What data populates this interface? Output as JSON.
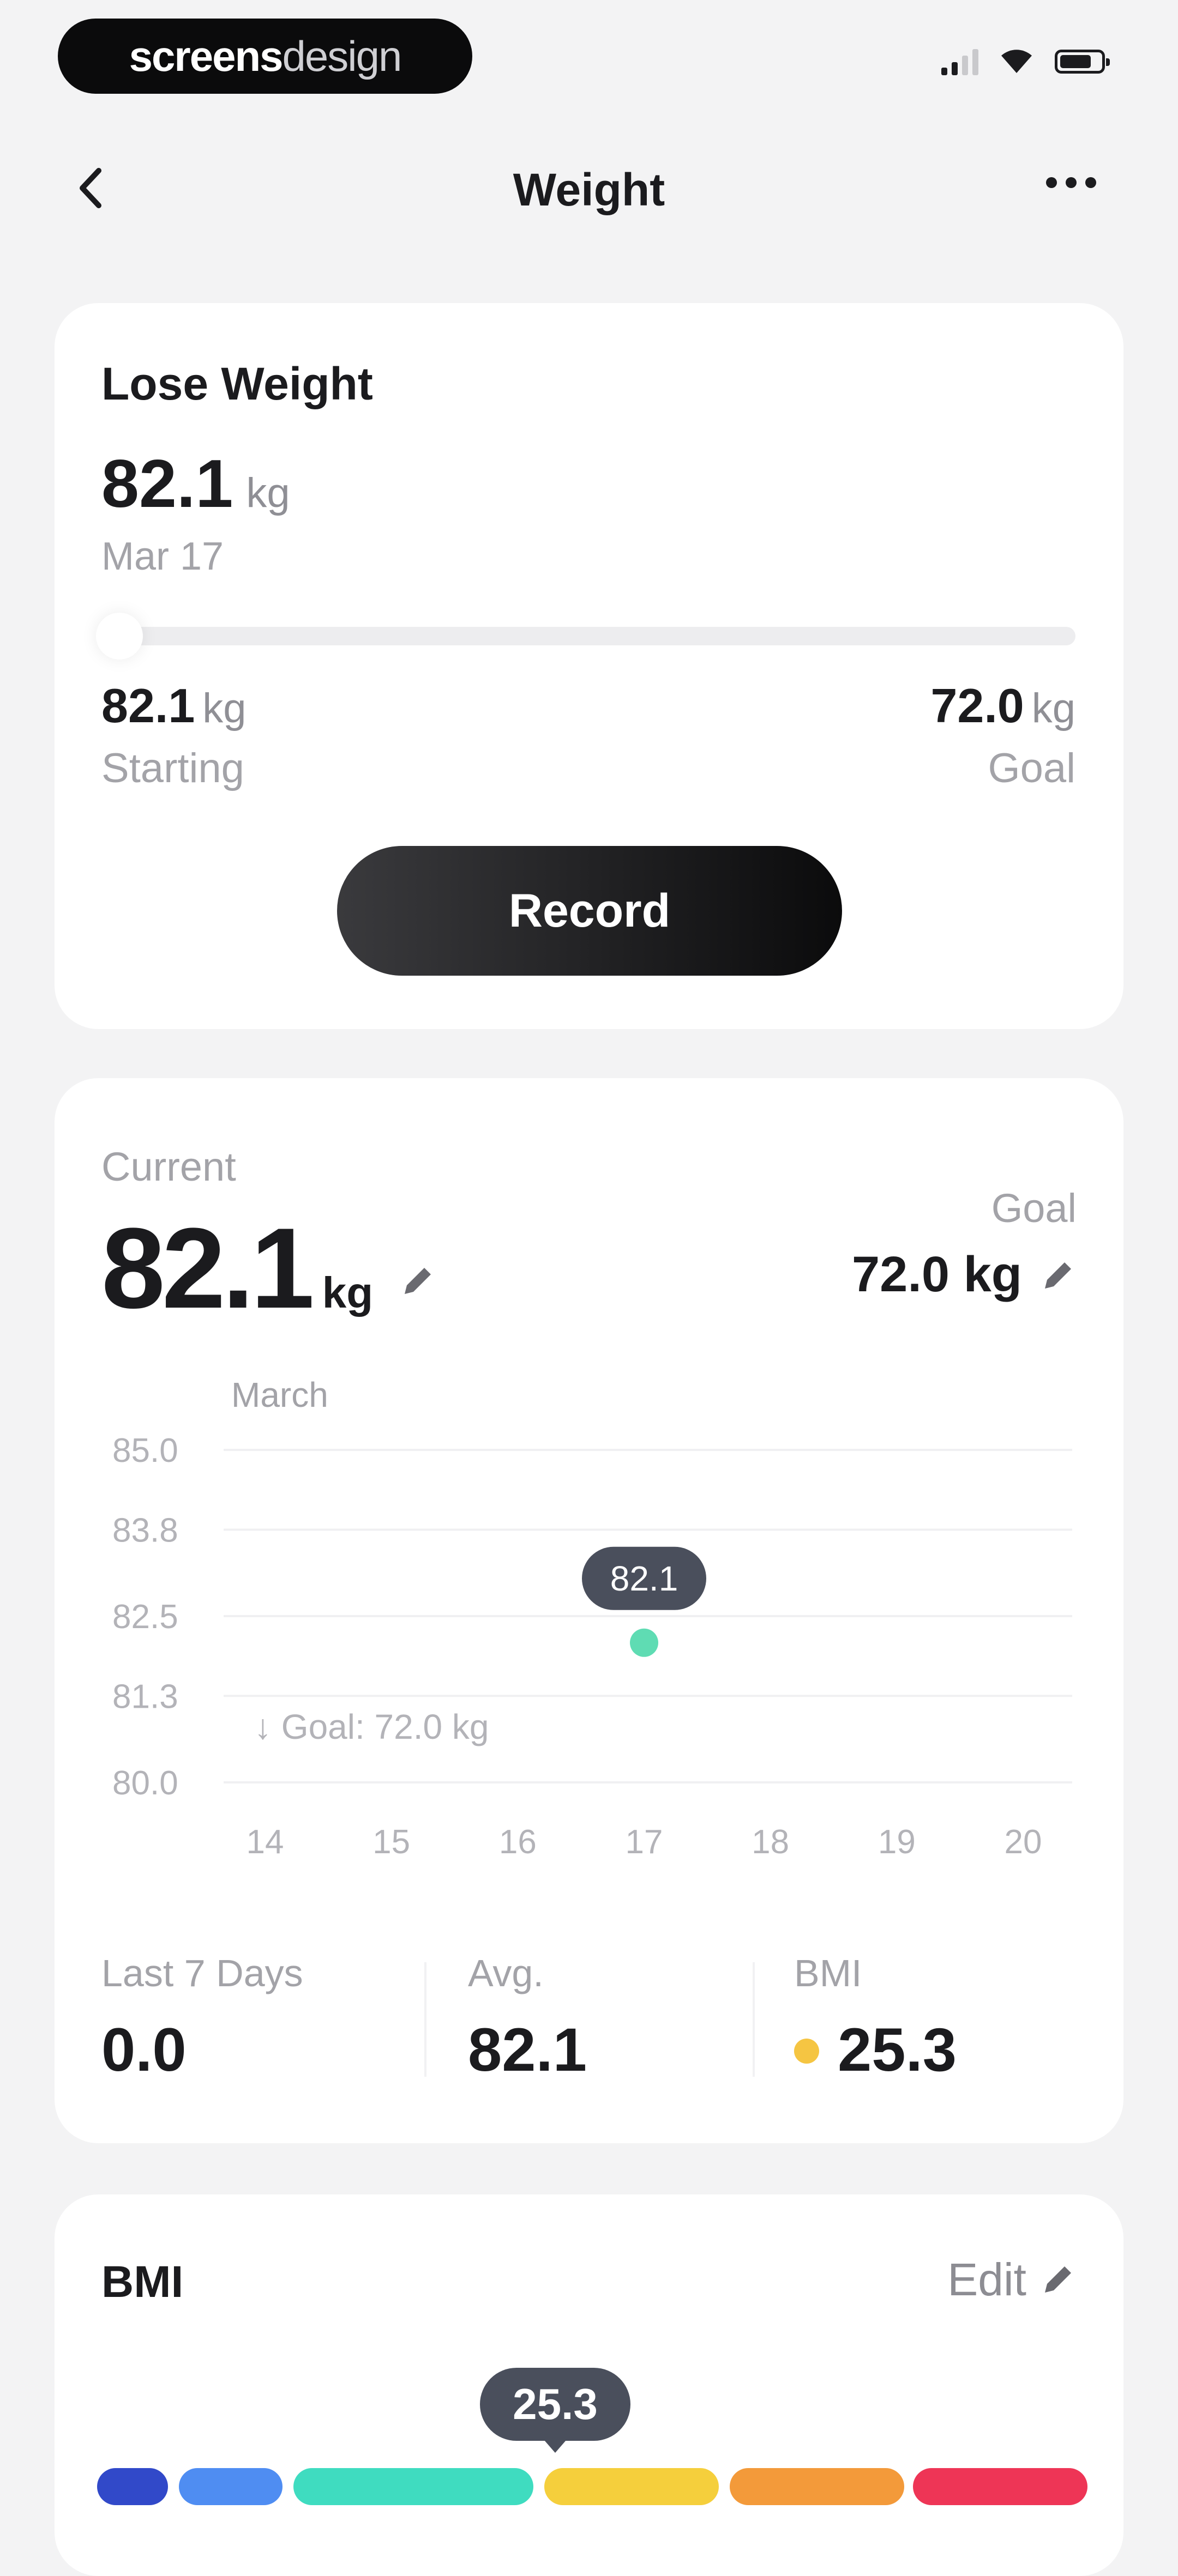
{
  "status_bar": {
    "brand_thin": "screens",
    "brand_bold": "design"
  },
  "header": {
    "title": "Weight"
  },
  "goal_card": {
    "title": "Lose Weight",
    "current_value": "82.1",
    "unit": "kg",
    "date": "Mar 17",
    "progress_fraction": 0,
    "start_value": "82.1",
    "start_label": "Starting",
    "goal_value": "72.0",
    "goal_label": "Goal",
    "record_label": "Record"
  },
  "summary_card": {
    "current_label": "Current",
    "current_value": "82.1",
    "current_unit": "kg",
    "goal_label": "Goal",
    "goal_value": "72.0 kg",
    "stats": [
      {
        "label": "Last 7 Days",
        "value": "0.0"
      },
      {
        "label": "Avg.",
        "value": "82.1"
      },
      {
        "label": "BMI",
        "value": "25.3"
      }
    ],
    "bmi_dot_color": "#f5c542"
  },
  "chart_data": {
    "type": "scatter",
    "month_label": "March",
    "y_ticks": [
      "85.0",
      "83.8",
      "82.5",
      "81.3",
      "80.0"
    ],
    "ylim": [
      80.0,
      85.0
    ],
    "x_ticks": [
      "14",
      "15",
      "16",
      "17",
      "18",
      "19",
      "20"
    ],
    "points": [
      {
        "x": 17,
        "y": 82.1,
        "label": "82.1"
      }
    ],
    "goal_annotation": "↓ Goal: 72.0 kg",
    "point_color": "#5fdcb3",
    "grid": true
  },
  "bmi_card": {
    "title": "BMI",
    "edit_label": "Edit",
    "value_tooltip": "25.3",
    "segment_colors": [
      "#3149c9",
      "#4f8df2",
      "#3fdcc0",
      "#f5cf3c",
      "#f39a3a",
      "#ee3556"
    ]
  }
}
